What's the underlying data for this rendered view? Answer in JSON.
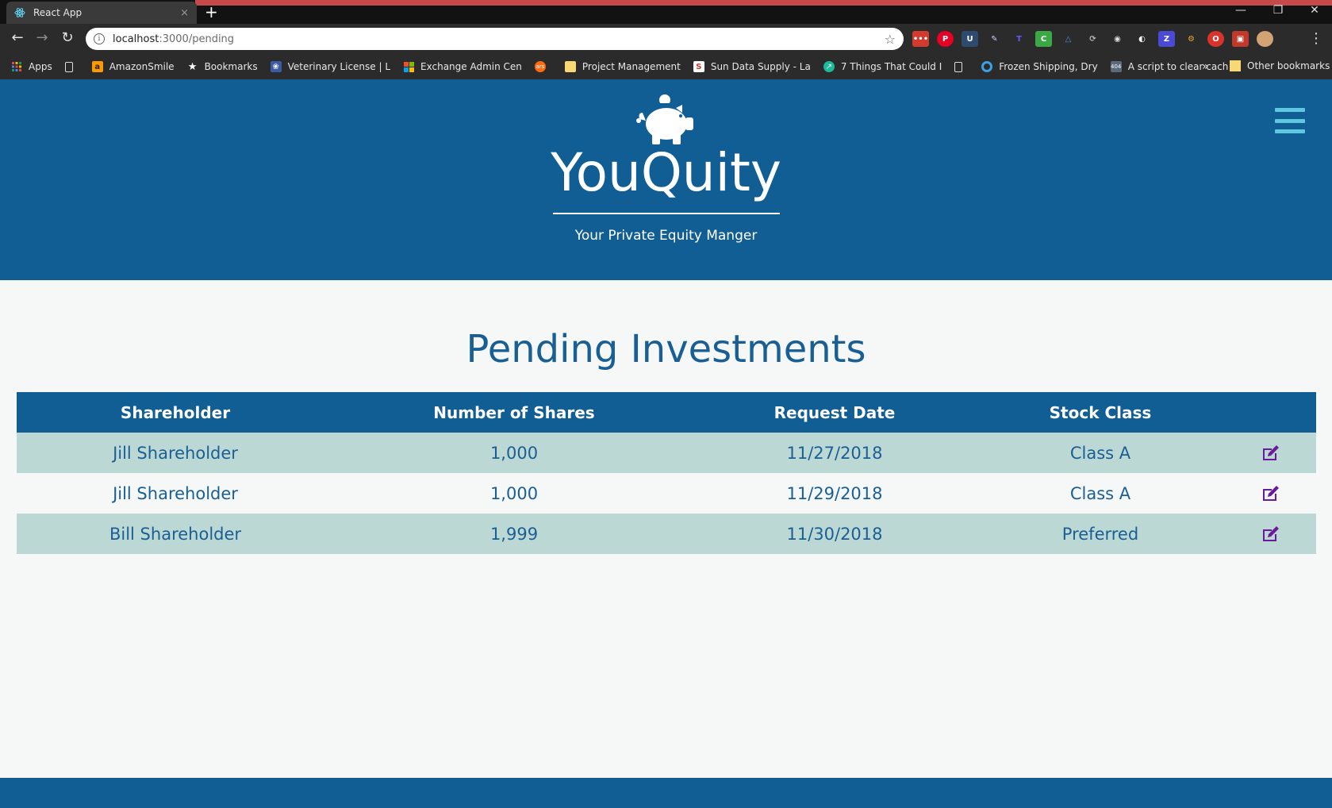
{
  "browser": {
    "tab_title": "React App",
    "tab_close": "×",
    "new_tab": "+",
    "url_host": "localhost",
    "url_path": ":3000/pending",
    "bookmarks": [
      {
        "label": "Apps",
        "icon": "apps-grid-icon"
      },
      {
        "label": "",
        "icon": "page-icon"
      },
      {
        "label": "AmazonSmile",
        "icon": "amazon-icon"
      },
      {
        "label": "Bookmarks",
        "icon": "star-icon"
      },
      {
        "label": "Veterinary License | L",
        "icon": "paw-icon"
      },
      {
        "label": "Exchange Admin Cen",
        "icon": "windows-icon"
      },
      {
        "label": "",
        "icon": "ars-icon"
      },
      {
        "label": "Project Management",
        "icon": "folder-icon"
      },
      {
        "label": "Sun Data Supply - La",
        "icon": "s-icon"
      },
      {
        "label": "7 Things That Could I",
        "icon": "arrow-circle-icon"
      },
      {
        "label": "",
        "icon": "page-icon"
      },
      {
        "label": "Frozen Shipping, Dry",
        "icon": "circle-icon"
      },
      {
        "label": "A script to clear cach",
        "icon": "404-icon"
      }
    ],
    "more_bookmarks": "»",
    "other_bookmarks": "Other bookmarks"
  },
  "header": {
    "title": "YouQuity",
    "tagline": "Your Private Equity Manger"
  },
  "main": {
    "title": "Pending Investments",
    "columns": [
      "Shareholder",
      "Number of Shares",
      "Request Date",
      "Stock Class"
    ],
    "rows": [
      {
        "shareholder": "Jill Shareholder",
        "shares": "1,000",
        "date": "11/27/2018",
        "stock_class": "Class A"
      },
      {
        "shareholder": "Jill Shareholder",
        "shares": "1,000",
        "date": "11/29/2018",
        "stock_class": "Class A"
      },
      {
        "shareholder": "Bill Shareholder",
        "shares": "1,999",
        "date": "11/30/2018",
        "stock_class": "Preferred"
      }
    ]
  },
  "colors": {
    "header_bg": "#105e94",
    "accent_text": "#1a5f93",
    "row_shaded": "#bcd8d5",
    "edit_icon": "#6a1b9a",
    "hamburger": "#5fc8e0"
  }
}
